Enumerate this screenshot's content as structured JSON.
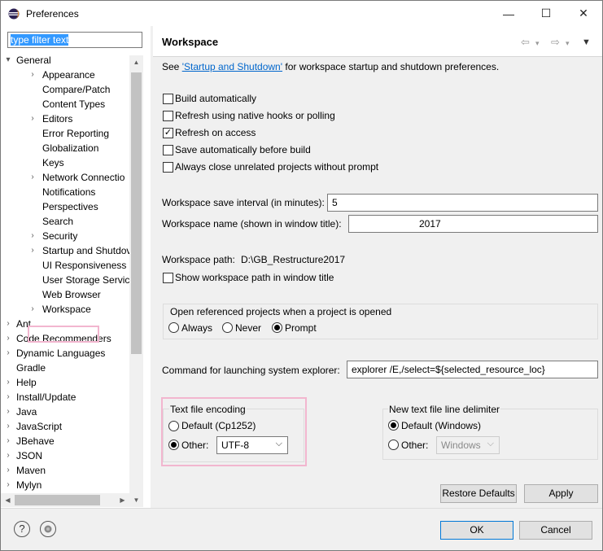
{
  "window": {
    "title": "Preferences",
    "minimize": "—",
    "maximize": "☐",
    "close": "✕"
  },
  "filter": {
    "value": "type filter text"
  },
  "tree": {
    "items": [
      {
        "label": "General",
        "level": 0,
        "arrow": "▾"
      },
      {
        "label": "Appearance",
        "level": 1,
        "arrow": "›"
      },
      {
        "label": "Compare/Patch",
        "level": 1,
        "arrow": ""
      },
      {
        "label": "Content Types",
        "level": 1,
        "arrow": ""
      },
      {
        "label": "Editors",
        "level": 1,
        "arrow": "›"
      },
      {
        "label": "Error Reporting",
        "level": 1,
        "arrow": ""
      },
      {
        "label": "Globalization",
        "level": 1,
        "arrow": ""
      },
      {
        "label": "Keys",
        "level": 1,
        "arrow": ""
      },
      {
        "label": "Network Connectio",
        "level": 1,
        "arrow": "›"
      },
      {
        "label": "Notifications",
        "level": 1,
        "arrow": ""
      },
      {
        "label": "Perspectives",
        "level": 1,
        "arrow": ""
      },
      {
        "label": "Search",
        "level": 1,
        "arrow": ""
      },
      {
        "label": "Security",
        "level": 1,
        "arrow": "›"
      },
      {
        "label": "Startup and Shutdov",
        "level": 1,
        "arrow": "›"
      },
      {
        "label": "UI Responsiveness M",
        "level": 1,
        "arrow": ""
      },
      {
        "label": "User Storage Service",
        "level": 1,
        "arrow": ""
      },
      {
        "label": "Web Browser",
        "level": 1,
        "arrow": ""
      },
      {
        "label": "Workspace",
        "level": 1,
        "arrow": "›",
        "selected": true
      },
      {
        "label": "Ant",
        "level": 0,
        "arrow": "›"
      },
      {
        "label": "Code Recommenders",
        "level": 0,
        "arrow": "›"
      },
      {
        "label": "Dynamic Languages",
        "level": 0,
        "arrow": "›"
      },
      {
        "label": "Gradle",
        "level": 0,
        "arrow": ""
      },
      {
        "label": "Help",
        "level": 0,
        "arrow": "›"
      },
      {
        "label": "Install/Update",
        "level": 0,
        "arrow": "›"
      },
      {
        "label": "Java",
        "level": 0,
        "arrow": "›"
      },
      {
        "label": "JavaScript",
        "level": 0,
        "arrow": "›"
      },
      {
        "label": "JBehave",
        "level": 0,
        "arrow": "›"
      },
      {
        "label": "JSON",
        "level": 0,
        "arrow": "›"
      },
      {
        "label": "Maven",
        "level": 0,
        "arrow": "›"
      },
      {
        "label": "Mylyn",
        "level": 0,
        "arrow": "›"
      }
    ]
  },
  "page": {
    "title": "Workspace",
    "intro_prefix": "See ",
    "intro_link": "'Startup and Shutdown'",
    "intro_suffix": " for workspace startup and shutdown preferences.",
    "checkboxes": [
      {
        "label": "Build automatically",
        "checked": false
      },
      {
        "label": "Refresh using native hooks or polling",
        "checked": false
      },
      {
        "label": "Refresh on access",
        "checked": true
      },
      {
        "label": "Save automatically before build",
        "checked": false
      },
      {
        "label": "Always close unrelated projects without prompt",
        "checked": false
      }
    ],
    "save_interval_label": "Workspace save interval (in minutes):",
    "save_interval_value": "5",
    "ws_name_label": "Workspace name (shown in window title):",
    "ws_name_value": "2017",
    "ws_path_label": "Workspace path:",
    "ws_path_value": "D:\\GB_Restructure2017",
    "show_path_label": "Show workspace path in window title",
    "open_ref": {
      "legend": "Open referenced projects when a project is opened",
      "options": [
        "Always",
        "Never",
        "Prompt"
      ],
      "selected": "Prompt"
    },
    "cmd_label": "Command for launching system explorer:",
    "cmd_value": "explorer /E,/select=${selected_resource_loc}",
    "encoding": {
      "legend": "Text file encoding",
      "default_label": "Default (Cp1252)",
      "other_label": "Other:",
      "other_value": "UTF-8",
      "selected": "Other"
    },
    "delimiter": {
      "legend": "New text file line delimiter",
      "default_label": "Default (Windows)",
      "other_label": "Other:",
      "other_value": "Windows",
      "selected": "Default"
    },
    "restore_defaults": "Restore Defaults",
    "apply": "Apply"
  },
  "footer": {
    "help_icon": "?",
    "ok": "OK",
    "cancel": "Cancel"
  }
}
